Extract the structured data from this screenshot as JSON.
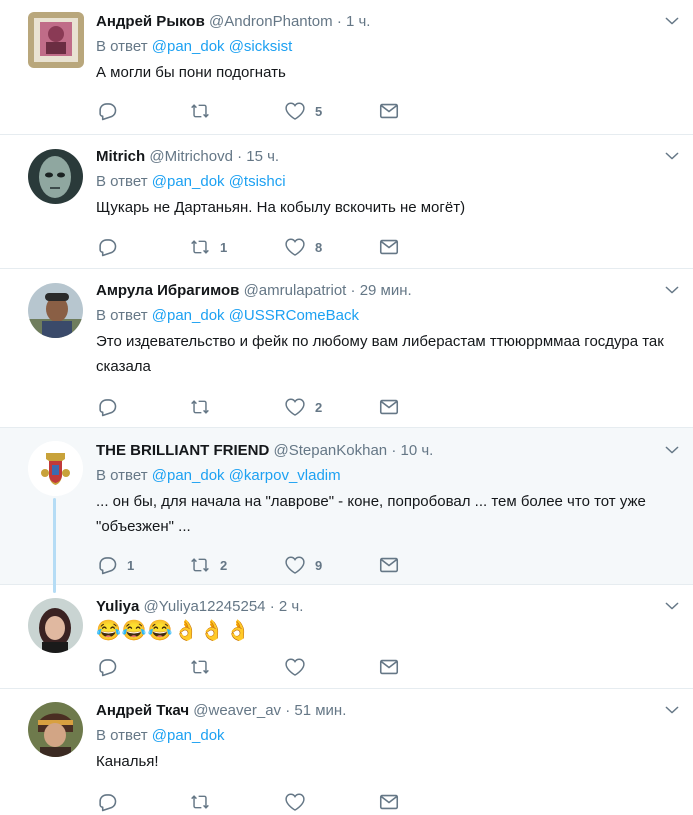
{
  "labels": {
    "reply_prefix": "В ответ"
  },
  "colors": {
    "link": "#1da1f2",
    "muted": "#657786",
    "text": "#14171a",
    "divider": "#e6ecf0",
    "highlight_bg": "#f5f8fa"
  },
  "tweets": [
    {
      "name": "Андрей Рыков",
      "handle": "@AndronPhantom",
      "sep": "·",
      "time": "1 ч.",
      "reply_to": [
        "@pan_dok",
        "@sicksist"
      ],
      "text": "А могли бы пони подогнать",
      "counts": {
        "reply": "",
        "retweet": "",
        "like": "5"
      }
    },
    {
      "name": "Mitrich",
      "handle": "@Mitrichovd",
      "sep": "·",
      "time": "15 ч.",
      "reply_to": [
        "@pan_dok",
        "@tsishci"
      ],
      "text": "Щукарь не Дартаньян. На кобылу вскочить не могёт)",
      "counts": {
        "reply": "",
        "retweet": "1",
        "like": "8"
      }
    },
    {
      "name": "Амрула Ибрагимов",
      "handle": "@amrulapatriot",
      "sep": "·",
      "time": "29 мин.",
      "reply_to": [
        "@pan_dok",
        "@USSRComeBack"
      ],
      "text": "Это издевательство и фейк по любому вам либерастам ттююррммаа госдура так сказала",
      "counts": {
        "reply": "",
        "retweet": "",
        "like": "2"
      }
    },
    {
      "name": "THE BRILLIANT FRIEND",
      "handle": "@StepanKokhan",
      "sep": "·",
      "time": "10 ч.",
      "reply_to": [
        "@pan_dok",
        "@karpov_vladim"
      ],
      "text": "... он бы, для начала на \"лаврове\" - коне, попробовал ... тем более что тот уже \"объезжен\" ...",
      "counts": {
        "reply": "1",
        "retweet": "2",
        "like": "9"
      }
    },
    {
      "name": "Yuliya",
      "handle": "@Yuliya12245254",
      "sep": "·",
      "time": "2 ч.",
      "reply_to": [],
      "text": "😂😂😂👌👌👌",
      "counts": {
        "reply": "",
        "retweet": "",
        "like": ""
      }
    },
    {
      "name": "Андрей Ткач",
      "handle": "@weaver_av",
      "sep": "·",
      "time": "51 мин.",
      "reply_to": [
        "@pan_dok"
      ],
      "text": "Каналья!",
      "counts": {
        "reply": "",
        "retweet": "",
        "like": ""
      }
    }
  ]
}
